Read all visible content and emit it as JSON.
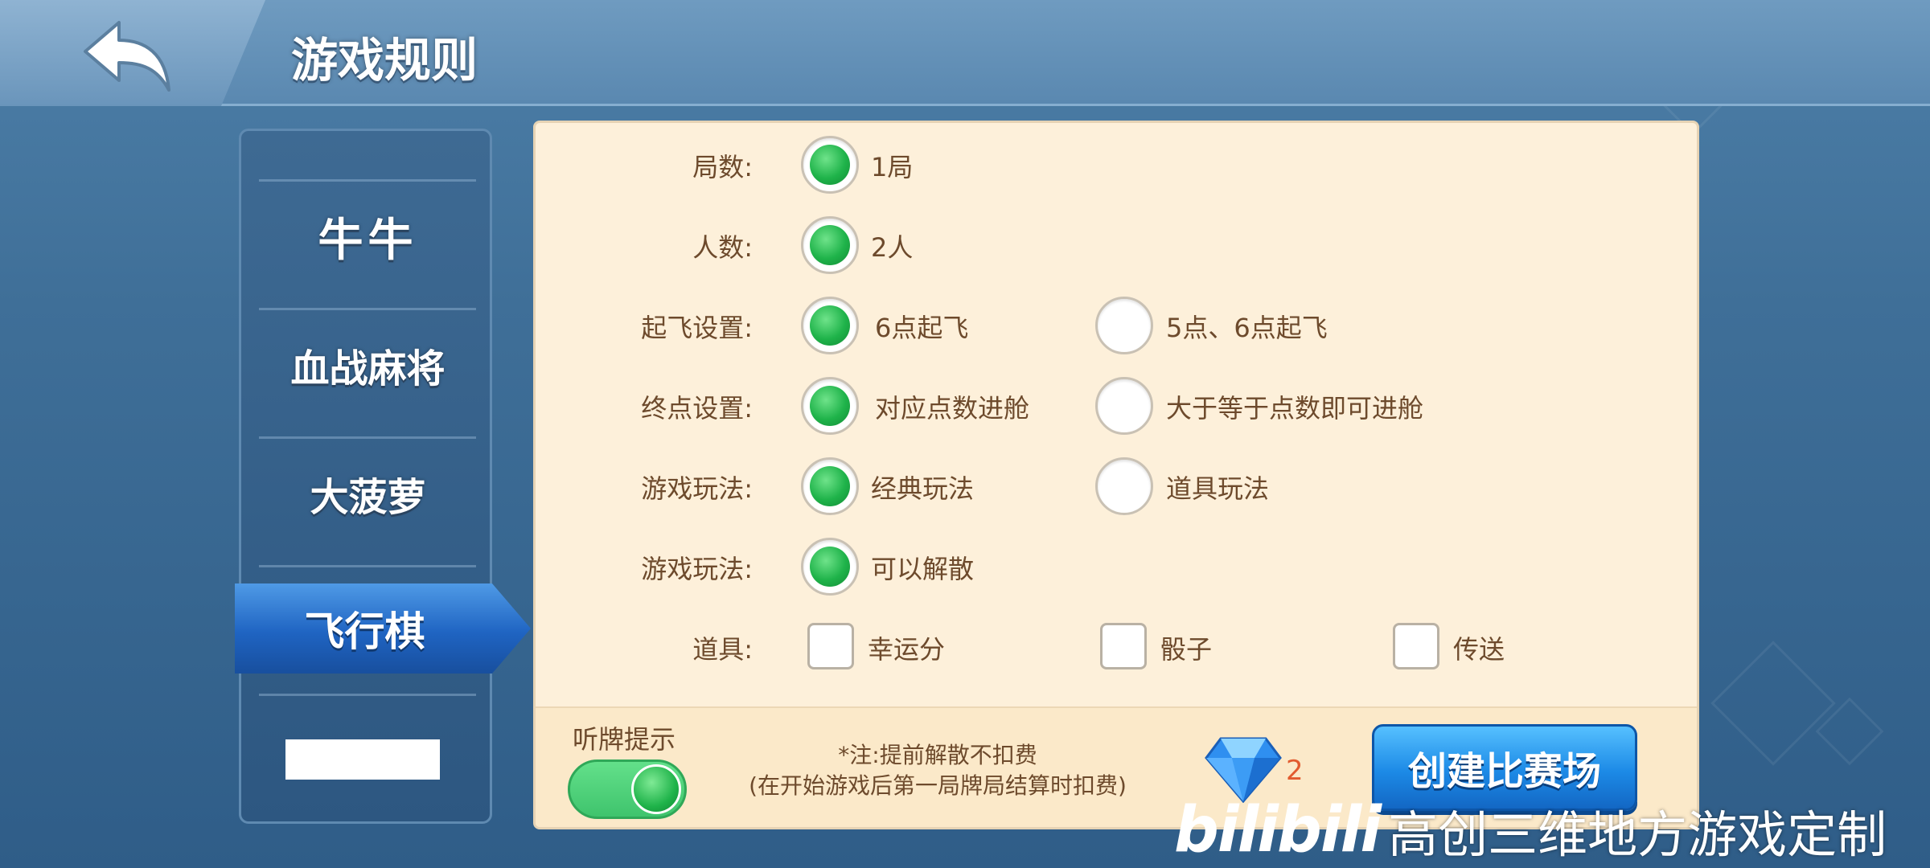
{
  "header": {
    "title": "游戏规则"
  },
  "sidebar": {
    "items": [
      {
        "label": "牛牛"
      },
      {
        "label": "血战麻将"
      },
      {
        "label": "大菠萝"
      },
      {
        "label": "飞行棋",
        "active": true
      }
    ]
  },
  "rules": {
    "rows": [
      {
        "label": "局数:",
        "options": [
          {
            "text": "1局",
            "selected": true
          }
        ]
      },
      {
        "label": "人数:",
        "options": [
          {
            "text": "2人",
            "selected": true
          }
        ]
      },
      {
        "label": "起飞设置:",
        "options": [
          {
            "text": "6点起飞",
            "selected": true
          },
          {
            "text": "5点、6点起飞",
            "selected": false
          }
        ]
      },
      {
        "label": "终点设置:",
        "options": [
          {
            "text": "对应点数进舱",
            "selected": true
          },
          {
            "text": "大于等于点数即可进舱",
            "selected": false
          }
        ]
      },
      {
        "label": "游戏玩法:",
        "options": [
          {
            "text": "经典玩法",
            "selected": true
          },
          {
            "text": "道具玩法",
            "selected": false
          }
        ]
      },
      {
        "label": "游戏玩法:",
        "options": [
          {
            "text": "可以解散",
            "selected": true
          }
        ]
      }
    ],
    "props": {
      "label": "道具:",
      "items": [
        {
          "text": "幸运分",
          "checked": false
        },
        {
          "text": "骰子",
          "checked": false
        },
        {
          "text": "传送",
          "checked": false
        }
      ]
    }
  },
  "footer": {
    "tingpai_label": "听牌提示",
    "tingpai_on": true,
    "note_line1": "*注:提前解散不扣费",
    "note_line2": "(在开始游戏后第一局牌局结算时扣费)",
    "gem_count": "2",
    "create_label": "创建比赛场"
  },
  "watermark": {
    "logo": "bilibili",
    "text": "高创三维地方游戏定制"
  },
  "colors": {
    "accent_blue": "#1c8ae6",
    "selected_green": "#1fb34a",
    "panel_bg": "#fdf0da",
    "text_brown": "#6d4a2c",
    "gem_count": "#e25b2f"
  }
}
